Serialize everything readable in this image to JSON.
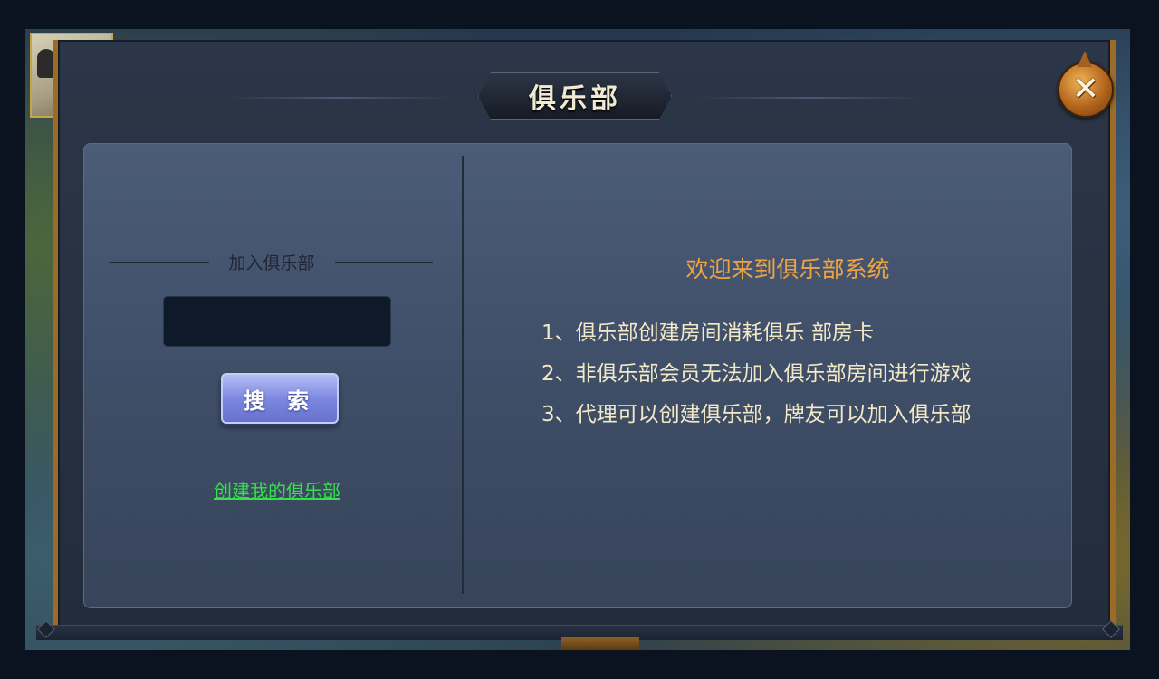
{
  "dialog": {
    "title": "俱乐部",
    "close_glyph": "✕"
  },
  "join": {
    "label": "加入俱乐部",
    "input_value": "",
    "input_placeholder": "",
    "search_label": "搜 索",
    "create_link": "创建我的俱乐部"
  },
  "info": {
    "welcome": "欢迎来到俱乐部系统",
    "rules": [
      "1、俱乐部创建房间消耗俱乐 部房卡",
      "2、非俱乐部会员无法加入俱乐部房间进行游戏",
      "3、代理可以创建俱乐部，牌友可以加入俱乐部"
    ]
  },
  "colors": {
    "accent_gold": "#f0a441",
    "link_green": "#34e04c",
    "frame_bronze": "#9c6b28",
    "button_blue": "#7d89df"
  },
  "icons": {
    "close": "close-icon"
  }
}
